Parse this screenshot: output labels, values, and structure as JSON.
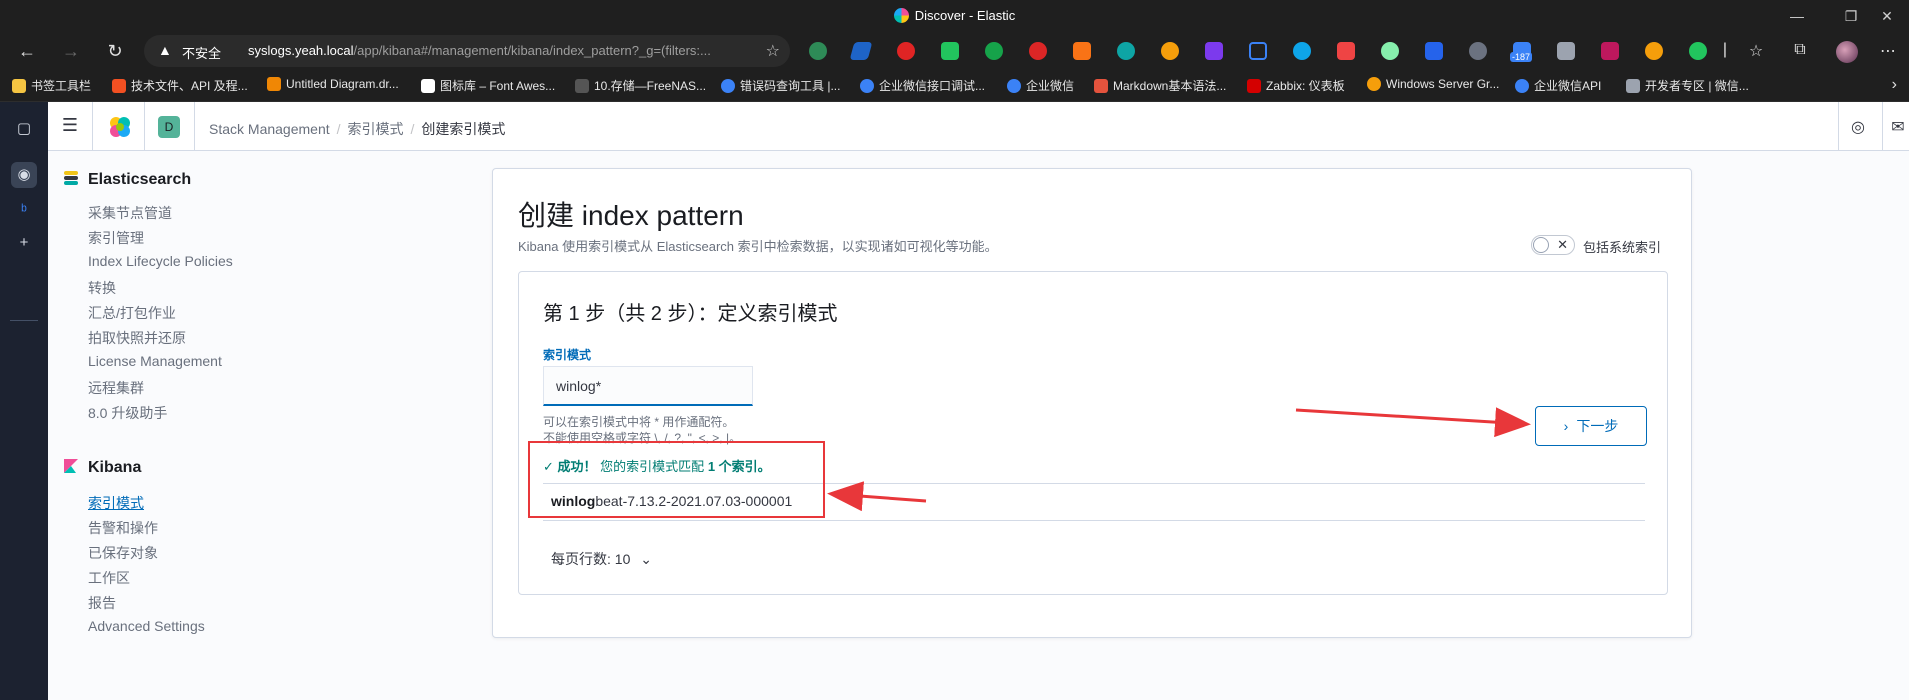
{
  "browser": {
    "window_title": "Discover - Elastic",
    "url": {
      "security_label": "不安全",
      "host": "syslogs.yeah.local",
      "path": "/app/kibana#/management/kibana/index_pattern?_g=(filters:..."
    },
    "extension_badge": "-187",
    "bookmarks": [
      {
        "label": "书签工具栏",
        "color": "#f5c542"
      },
      {
        "label": "技术文件、API 及程...",
        "color": "#f25022"
      },
      {
        "label": "Untitled Diagram.dr...",
        "color": "#f08705"
      },
      {
        "label": "图标库 – Font Awes...",
        "color": "#ffffff"
      },
      {
        "label": "10.存储—FreeNAS...",
        "color": "#555555"
      },
      {
        "label": "错误码查询工具 |...",
        "color": "#3b82f6"
      },
      {
        "label": "企业微信接口调试...",
        "color": "#3b82f6"
      },
      {
        "label": "企业微信",
        "color": "#3b82f6"
      },
      {
        "label": "Markdown基本语法...",
        "color": "#e5533d"
      },
      {
        "label": "Zabbix: 仪表板",
        "color": "#d40000"
      },
      {
        "label": "Windows Server Gr...",
        "color": "#f59e0b"
      },
      {
        "label": "企业微信API",
        "color": "#3b82f6"
      },
      {
        "label": "开发者专区 | 微信...",
        "color": "#9ca3af"
      }
    ]
  },
  "kibana": {
    "space_initial": "D",
    "breadcrumbs": [
      "Stack Management",
      "索引模式",
      "创建索引模式"
    ],
    "sidenav": {
      "elasticsearch": {
        "title": "Elasticsearch",
        "items": [
          "采集节点管道",
          "索引管理",
          "Index Lifecycle Policies",
          "转换",
          "汇总/打包作业",
          "拍取快照并还原",
          "License Management",
          "远程集群",
          "8.0 升级助手"
        ]
      },
      "kibana": {
        "title": "Kibana",
        "items": [
          "索引模式",
          "告警和操作",
          "已保存对象",
          "工作区",
          "报告",
          "Advanced Settings"
        ],
        "active_index": 0
      }
    },
    "page": {
      "title": "创建 index pattern",
      "description": "Kibana 使用索引模式从 Elasticsearch 索引中检索数据，以实现诸如可视化等功能。",
      "toggle_label": "包括系统索引",
      "step_title": "第 1 步（共 2 步）：定义索引模式",
      "field_label": "索引模式",
      "field_value": "winlog*",
      "help_line1": "可以在索引模式中将 * 用作通配符。",
      "help_line2": "不能使用空格或字符 \\, /, ?, \", <, >, |。",
      "success_prefix": "成功！",
      "success_text": "您的索引模式匹配",
      "success_count": "1 个索引。",
      "index_match": "winlog",
      "index_rest": "beat-7.13.2-2021.07.03-000001",
      "per_page_label": "每页行数: 10",
      "next_button": "下一步"
    }
  },
  "colors": {
    "accent": "#006bb8",
    "success": "#017d73",
    "annotation_red": "#e8373a"
  }
}
